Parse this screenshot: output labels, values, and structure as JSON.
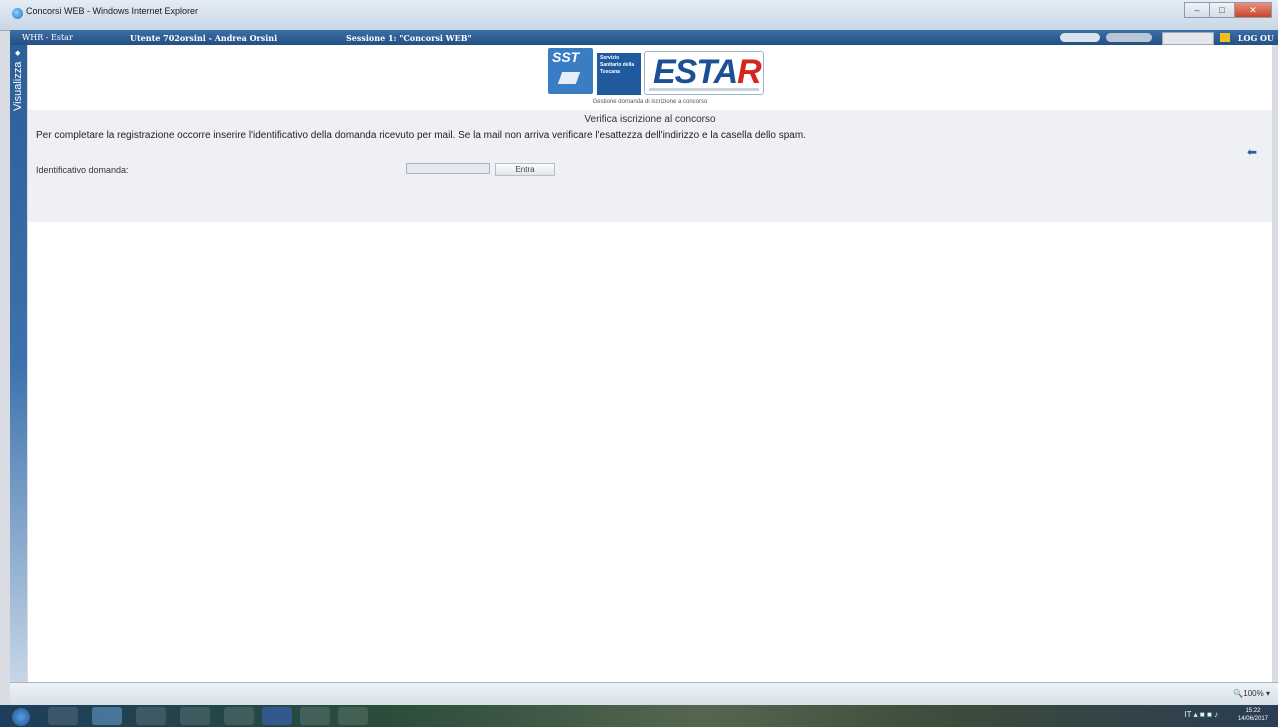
{
  "window": {
    "title": "Concorsi WEB - Windows Internet Explorer",
    "controls": [
      "minimize",
      "maximize",
      "close"
    ]
  },
  "appbar": {
    "brand": "WHR - Estar",
    "user": "Utente 702orsini - Andrea Orsini",
    "session": "Sessione 1: \"Concorsi WEB\"",
    "logout": "LOG OU"
  },
  "sidebar": {
    "label": "Visualizza"
  },
  "logos": {
    "sst": "SST",
    "sst_caption": "Servizio Sanitario della Toscana",
    "estar_left": "ESTA",
    "estar_right": "R"
  },
  "page": {
    "subtitle": "Gestione domanda di iscrizione a concorso",
    "section_title": "Verifica iscrizione al concorso",
    "instructions": "Per completare la registrazione occorre inserire l'identificativo della domanda ricevuto per mail. Se la mail non arriva verificare l'esattezza dell'indirizzo e la casella dello spam.",
    "field_label": "Identificativo domanda:",
    "field_value": "",
    "enter_button": "Entra"
  },
  "statusbar": {
    "zoom": "100%"
  },
  "taskbar": {
    "time": "15:22",
    "date": "14/06/2017",
    "language": "IT"
  },
  "colors": {
    "appbar": "#2f5f96",
    "band": "#eef0f5",
    "estar_blue": "#1d4f95",
    "estar_red": "#d4261e"
  }
}
